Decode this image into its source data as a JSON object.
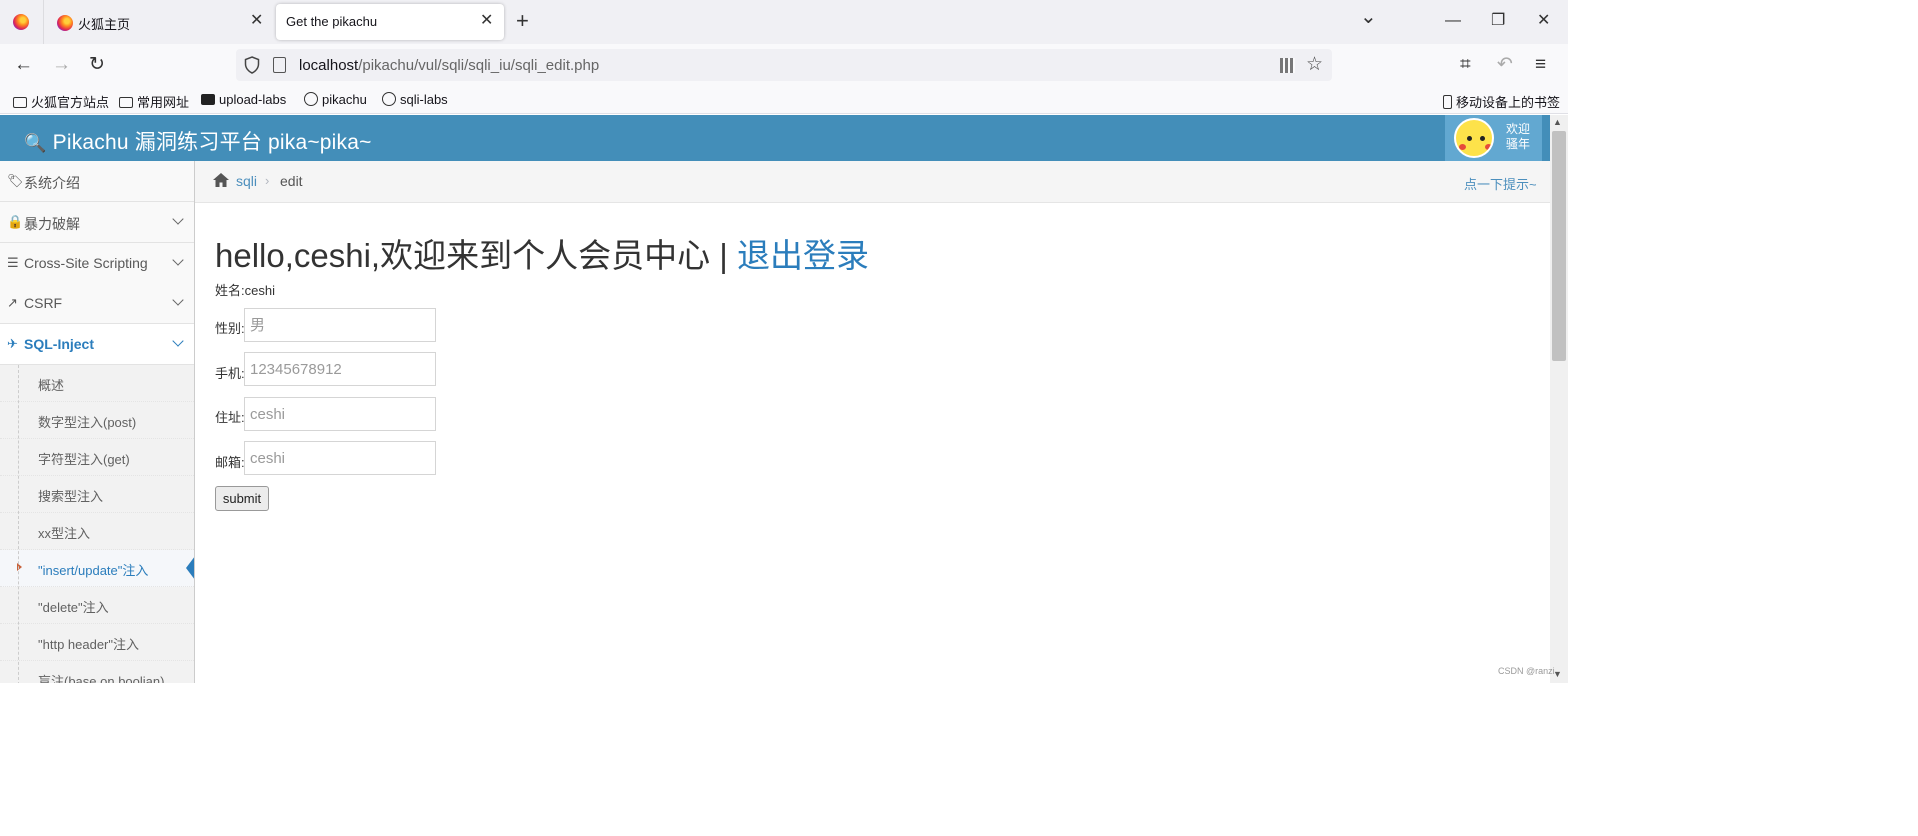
{
  "browser": {
    "tabs": [
      {
        "title": "火狐主页",
        "close": "✕"
      },
      {
        "title": "Get the pikachu",
        "close": "✕"
      }
    ],
    "new_tab": "+",
    "window_controls": {
      "list": "⌄",
      "minimize": "—",
      "restore": "❐",
      "close": "✕"
    },
    "nav": {
      "back": "←",
      "forward": "→",
      "reload": "↻",
      "extensions": "⌗",
      "undo": "↶",
      "menu": "≡"
    },
    "url": {
      "host": "localhost",
      "path": "/pikachu/vul/sqli/sqli_iu/sqli_edit.php"
    },
    "star": "☆",
    "bookmarks": [
      {
        "label": "火狐官方站点",
        "icon": "folder-icon"
      },
      {
        "label": "常用网址",
        "icon": "folder-icon"
      },
      {
        "label": "upload-labs",
        "icon": "site-icon"
      },
      {
        "label": "pikachu",
        "icon": "globe-icon"
      },
      {
        "label": "sqli-labs",
        "icon": "globe-icon"
      }
    ],
    "mobile_bookmarks": "移动设备上的书签"
  },
  "site": {
    "brand": "Pikachu 漏洞练习平台 pika~pika~",
    "brand_icon": "🔍",
    "user": {
      "line1": "欢迎",
      "line2": "骚年"
    },
    "colors": {
      "header": "#438eb9",
      "accent": "#2b7dbc",
      "link": "#4c8fbd"
    }
  },
  "sidebar": {
    "items": [
      {
        "label": "系统介绍",
        "icon": "tag-icon",
        "glyph": "🏷"
      },
      {
        "label": "暴力破解",
        "icon": "lock-icon",
        "glyph": "🔒"
      },
      {
        "label": "Cross-Site Scripting",
        "icon": "tree-icon",
        "glyph": "☰"
      },
      {
        "label": "CSRF",
        "icon": "share-icon",
        "glyph": "↗"
      },
      {
        "label": "SQL-Inject",
        "icon": "plane-icon",
        "glyph": "✈"
      }
    ],
    "submenu": [
      "概述",
      "数字型注入(post)",
      "字符型注入(get)",
      "搜索型注入",
      "xx型注入",
      "\"insert/update\"注入",
      "\"delete\"注入",
      "\"http header\"注入",
      "盲注(base on boolian)"
    ]
  },
  "breadcrumb": {
    "link": "sqli",
    "separator": "›",
    "current": "edit",
    "hint": "点一下提示~"
  },
  "main": {
    "title": "hello,ceshi,欢迎来到个人会员中心 | ",
    "logout": "退出登录",
    "name_row": "姓名:ceshi",
    "fields": [
      {
        "label": "性别:",
        "placeholder": "男"
      },
      {
        "label": "手机:",
        "placeholder": "12345678912"
      },
      {
        "label": "住址:",
        "placeholder": "ceshi"
      },
      {
        "label": "邮箱:",
        "placeholder": "ceshi"
      }
    ],
    "submit": "submit"
  },
  "watermark": "CSDN @ranzi"
}
